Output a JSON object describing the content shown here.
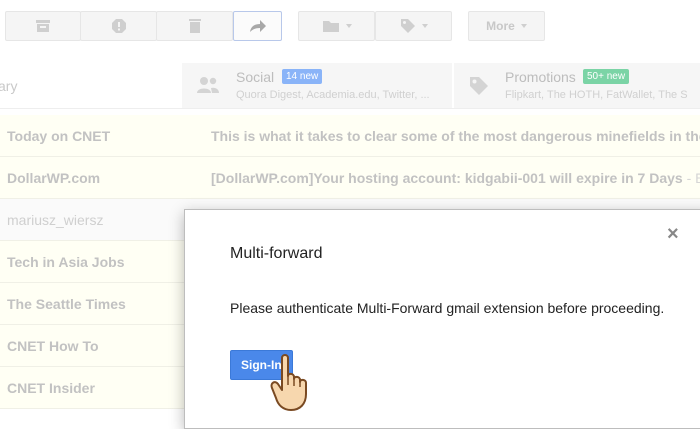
{
  "toolbar": {
    "archive_icon": "archive-icon",
    "spam_icon": "report-spam-icon",
    "delete_icon": "delete-icon",
    "forward_icon": "forward-arrow-icon",
    "move_icon": "folder-icon",
    "label_icon": "tag-icon",
    "more_label": "More"
  },
  "tabs": {
    "primary_partial": "ary",
    "social": {
      "name": "Social",
      "badge": "14 new",
      "badge_color": "#8ab4f8",
      "snippet": "Quora Digest, Academia.edu, Twitter, ..."
    },
    "promotions": {
      "name": "Promotions",
      "badge": "50+ new",
      "badge_color": "#7bd4a6",
      "snippet": "Flipkart, The HOTH, FatWallet, The S"
    }
  },
  "emails": [
    {
      "sender": "Today on CNET",
      "subject": "This is what it takes to clear some of the most dangerous minefields in the w",
      "snippet": "",
      "read": false
    },
    {
      "sender": "DollarWP.com",
      "subject": "[DollarWP.com]Your hosting account: kidgabii-001 will expire in 7 Days",
      "snippet": " - Ex",
      "read": false
    },
    {
      "sender": "mariusz_wiersz",
      "subject": "",
      "snippet": "",
      "read": true
    },
    {
      "sender": "Tech in Asia Jobs",
      "subject": "",
      "snippet": "",
      "read": false
    },
    {
      "sender": "The Seattle Times",
      "subject": "",
      "snippet": "",
      "read": false
    },
    {
      "sender": "CNET How To",
      "subject": "",
      "snippet": "",
      "read": false
    },
    {
      "sender": "CNET Insider",
      "subject": "",
      "snippet": "",
      "read": false
    }
  ],
  "dialog": {
    "title": "Multi-forward",
    "message": "Please authenticate Multi-Forward gmail extension before proceeding.",
    "close": "×",
    "signin_label": "Sign-In"
  },
  "colors": {
    "accent": "#4a88ea",
    "unread_bg": "#fffff4"
  }
}
